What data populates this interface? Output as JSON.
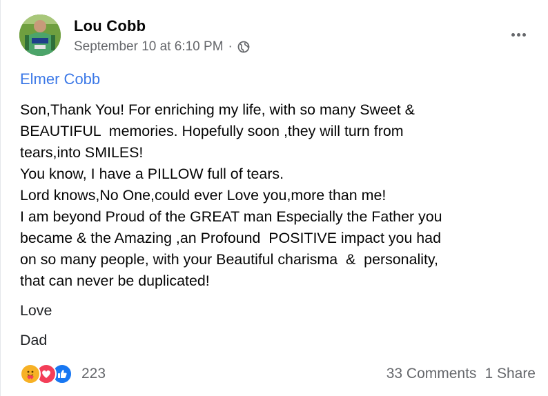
{
  "post": {
    "author": "Lou Cobb",
    "date": "September 10 at 6:10 PM",
    "separator": "·",
    "privacy_icon": "globe-icon",
    "tagged": "Elmer Cobb",
    "message": [
      "Son,Thank You! For enriching my life, with so many Sweet &",
      "BEAUTIFUL  memories. Hopefully soon ,they will turn from",
      "tears,into SMILES!",
      "You know, I have a PILLOW full of tears.",
      "Lord knows,No One,could ever Love you,more than me!",
      "I am beyond Proud of the GREAT man Especially the Father you",
      "became & the Amazing ,an Profound  POSITIVE impact you had",
      "on so many people, with your Beautiful charisma  &  personality,",
      "that can never be duplicated!"
    ],
    "closing": "Love",
    "signature": "Dad"
  },
  "footer": {
    "reactions": [
      "care-icon",
      "love-icon",
      "like-icon"
    ],
    "reaction_count": "223",
    "comments": "33 Comments",
    "shares": "1 Share"
  },
  "colors": {
    "link": "#3b78e7",
    "secondary_text": "#65676b",
    "like": "#1877f2",
    "love": "#f33e58",
    "care": "#f7b125"
  }
}
